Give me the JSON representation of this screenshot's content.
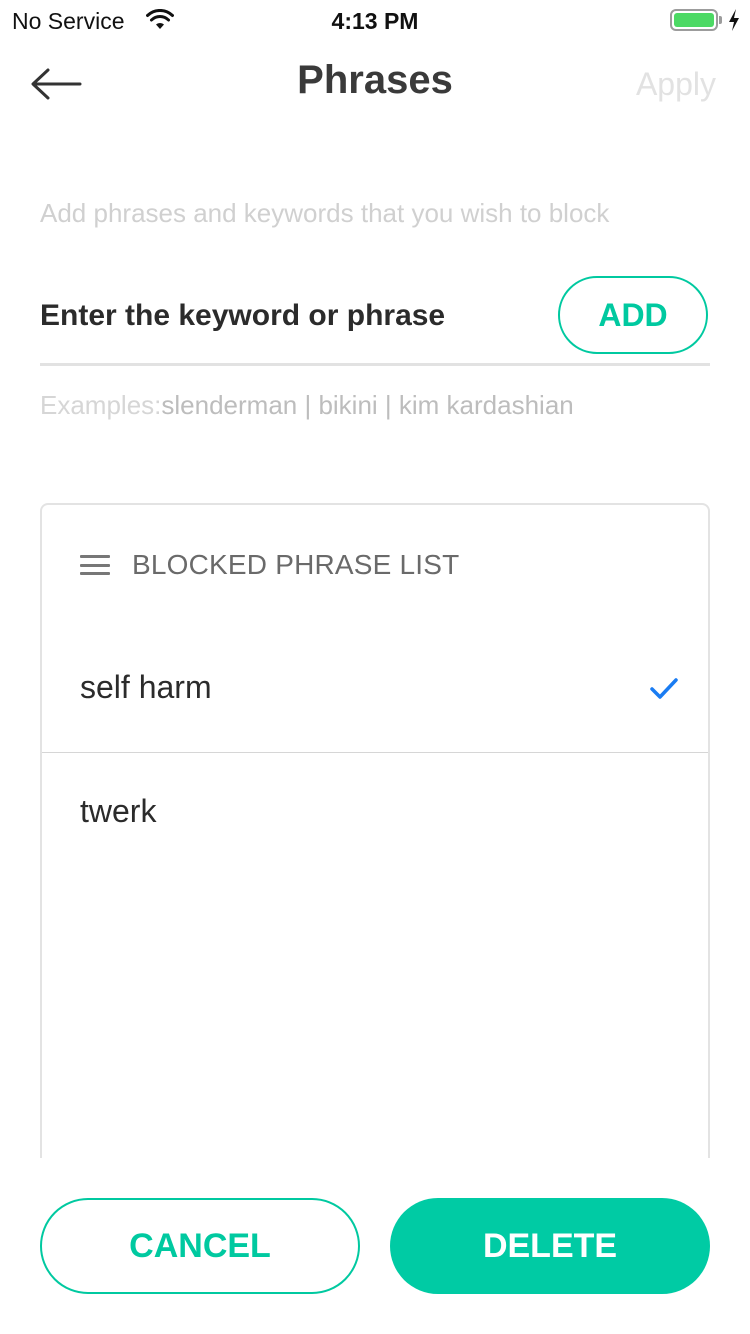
{
  "status_bar": {
    "carrier": "No Service",
    "time": "4:13 PM",
    "wifi_icon": "wifi-icon",
    "battery_icon": "battery-icon",
    "charging_icon": "lightning-bolt-icon",
    "battery_level": 1.0
  },
  "nav": {
    "back_icon": "arrow-left-icon",
    "title": "Phrases",
    "apply_label": "Apply"
  },
  "intro_hint": "Add phrases and keywords that you wish to block",
  "keyword_input": {
    "placeholder": "Enter the keyword or phrase",
    "value": ""
  },
  "add_button_label": "ADD",
  "examples": {
    "label": "Examples:",
    "values": "slenderman | bikini | kim kardashian"
  },
  "blocked_list": {
    "header_icon": "menu-icon",
    "title": "BLOCKED PHRASE LIST",
    "items": [
      {
        "text": "self harm",
        "selected": true
      },
      {
        "text": "twerk",
        "selected": false
      }
    ]
  },
  "actions": {
    "cancel_label": "CANCEL",
    "delete_label": "DELETE"
  },
  "colors": {
    "accent": "#00c9a0",
    "accent_fill": "#00cba4",
    "check": "#1a7cf2",
    "battery": "#4cd964"
  }
}
